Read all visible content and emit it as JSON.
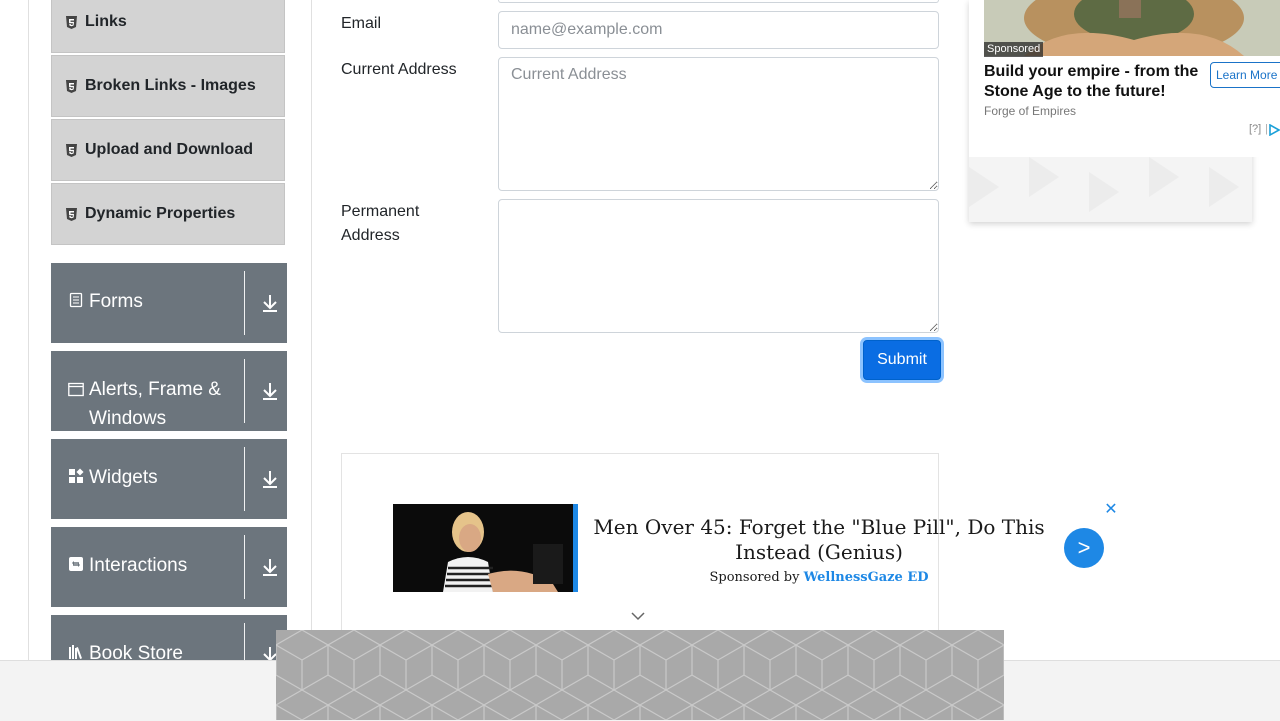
{
  "sidebar": {
    "sub_items": [
      {
        "label": "Links"
      },
      {
        "label": "Broken Links - Images"
      },
      {
        "label": "Upload and Download"
      },
      {
        "label": "Dynamic Properties"
      }
    ],
    "groups": [
      {
        "label": "Forms",
        "icon": "form-icon"
      },
      {
        "label": "Alerts, Frame & Windows",
        "icon": "window-icon"
      },
      {
        "label": "Widgets",
        "icon": "widgets-icon"
      },
      {
        "label": "Interactions",
        "icon": "interactions-icon"
      },
      {
        "label": "Book Store",
        "icon": "books-icon"
      }
    ]
  },
  "form": {
    "email_label": "Email",
    "email_placeholder": "name@example.com",
    "current_address_label": "Current Address",
    "current_address_placeholder": "Current Address",
    "permanent_address_label": "Permanent Address",
    "submit_label": "Submit"
  },
  "ad_main": {
    "title": "Men Over 45: Forget the \"Blue Pill\", Do This Instead (Genius)",
    "sponsored_by": "Sponsored by",
    "brand": "WellnessGaze ED",
    "close_symbol": "✕",
    "go_symbol": ">"
  },
  "ad_right": {
    "sponsored": "Sponsored",
    "title": "Build your empire - from the Stone Age to the future!",
    "brand": "Forge of Empires",
    "cta": "Learn More",
    "help": "[?]",
    "separator": "|"
  },
  "colors": {
    "primary": "#0a6de3",
    "group_bg": "#6c757d",
    "sub_bg": "#d3d3d3",
    "ad_blue": "#1e88e5"
  }
}
